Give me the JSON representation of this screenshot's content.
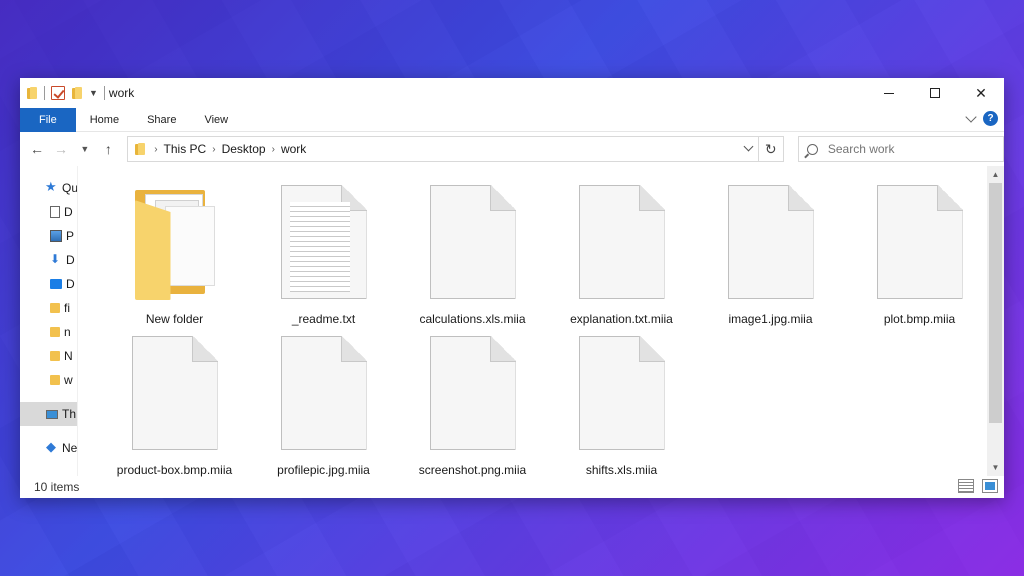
{
  "window": {
    "title": "work",
    "controls": {
      "minimize": "—",
      "maximize": "☐",
      "close": "✕"
    }
  },
  "ribbon": {
    "tabs": [
      "File",
      "Home",
      "Share",
      "View"
    ],
    "help": "?"
  },
  "address": {
    "crumbs": [
      "This PC",
      "Desktop",
      "work"
    ],
    "search_placeholder": "Search work"
  },
  "nav": {
    "items": [
      {
        "icon": "star-icon",
        "label": "Qu",
        "kind": "top"
      },
      {
        "icon": "document-icon",
        "label": "D"
      },
      {
        "icon": "pictures-icon",
        "label": "P"
      },
      {
        "icon": "download-icon",
        "label": "D"
      },
      {
        "icon": "desktop-icon",
        "label": "D"
      },
      {
        "icon": "folder-icon",
        "label": "fi"
      },
      {
        "icon": "folder-icon",
        "label": "n"
      },
      {
        "icon": "folder-icon",
        "label": "N"
      },
      {
        "icon": "folder-icon",
        "label": "w"
      },
      {
        "icon": "this-pc-icon",
        "label": "Th",
        "kind": "top",
        "selected": true
      },
      {
        "icon": "network-icon",
        "label": "Ne",
        "kind": "top"
      }
    ]
  },
  "files": [
    {
      "name": "New folder",
      "type": "folder"
    },
    {
      "name": "_readme.txt",
      "type": "text"
    },
    {
      "name": "calculations.xls.miia",
      "type": "blank"
    },
    {
      "name": "explanation.txt.miia",
      "type": "blank"
    },
    {
      "name": "image1.jpg.miia",
      "type": "blank"
    },
    {
      "name": "plot.bmp.miia",
      "type": "blank"
    },
    {
      "name": "product-box.bmp.miia",
      "type": "blank"
    },
    {
      "name": "profilepic.jpg.miia",
      "type": "blank"
    },
    {
      "name": "screenshot.png.miia",
      "type": "blank"
    },
    {
      "name": "shifts.xls.miia",
      "type": "blank"
    }
  ],
  "status": {
    "item_count": "10 items"
  },
  "scroll": {
    "visible_fraction": 0.87
  },
  "colors": {
    "accent": "#1a66c2",
    "folder": "#f7d36c"
  }
}
